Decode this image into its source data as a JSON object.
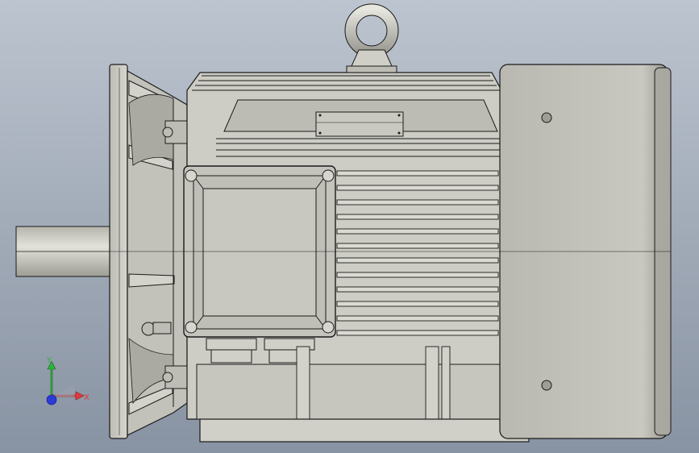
{
  "viewport": {
    "background_top": "#bcc4cf",
    "background_bottom": "#8893a3"
  },
  "model": {
    "description": "",
    "body_color": "#c9c9c1",
    "shadow_color": "#8c8c86",
    "line_color": "#1a1a1a"
  },
  "triad": {
    "y_label": "Y",
    "x_label": "X",
    "y_color": "#2db33a",
    "x_color": "#e23a3a",
    "z_color": "#2a3ad6"
  }
}
